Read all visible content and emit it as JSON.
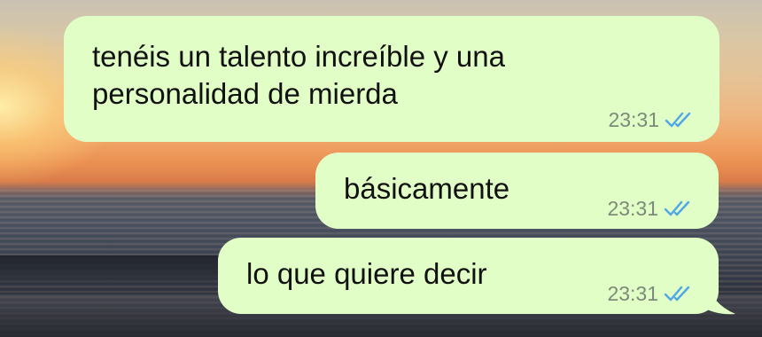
{
  "chat": {
    "messages": [
      {
        "text": "tenéis un talento increíble y una personalidad de mierda",
        "time": "23:31",
        "status": "read-double-check-icon"
      },
      {
        "text": "básicamente",
        "time": "23:31",
        "status": "read-double-check-icon"
      },
      {
        "text": "lo que quiere decir",
        "time": "23:31",
        "status": "read-double-check-icon"
      }
    ]
  },
  "colors": {
    "bubble": "#e1fec6",
    "read_ticks": "#4fa6e8",
    "timestamp": "#7d8a7a"
  }
}
